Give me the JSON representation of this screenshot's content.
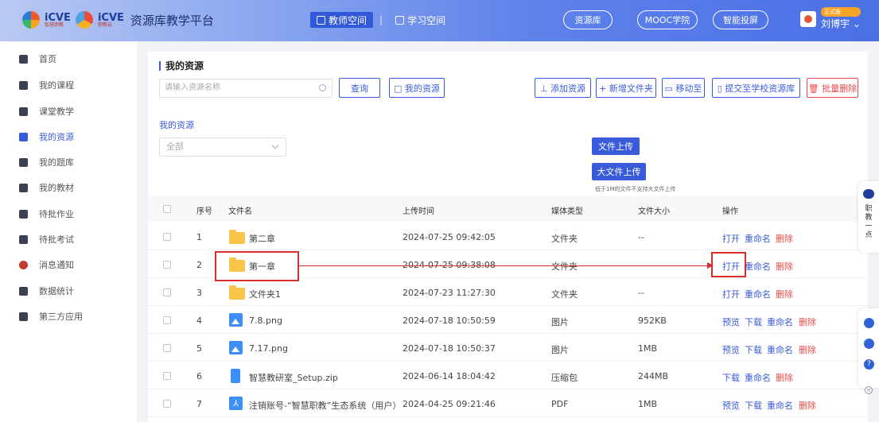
{
  "header": {
    "logo_text_1": "iCVE",
    "logo_sub_1": "智慧职教",
    "logo_text_2": "iCVE",
    "logo_sub_2": "职教云",
    "platform_title": "资源库教学平台",
    "nav_teacher": "教师空间",
    "nav_separator": "|",
    "nav_student": "学习空间",
    "pill_resource": "资源库",
    "pill_mooc": "MOOC学院",
    "pill_screen": "智能投屏",
    "user_badge": "正式版",
    "user_name": "刘博宇 ⌄"
  },
  "sidebar": {
    "items": [
      {
        "label": "首页",
        "icon": "home-icon"
      },
      {
        "label": "我的课程",
        "icon": "course-icon"
      },
      {
        "label": "课堂教学",
        "icon": "classroom-icon"
      },
      {
        "label": "我的资源",
        "icon": "resource-icon"
      },
      {
        "label": "我的题库",
        "icon": "question-bank-icon"
      },
      {
        "label": "我的教材",
        "icon": "textbook-icon"
      },
      {
        "label": "待批作业",
        "icon": "homework-icon"
      },
      {
        "label": "待批考试",
        "icon": "exam-icon"
      },
      {
        "label": "消息通知",
        "icon": "bell-icon"
      },
      {
        "label": "数据统计",
        "icon": "stats-icon"
      },
      {
        "label": "第三方应用",
        "icon": "apps-icon"
      }
    ]
  },
  "main": {
    "title": "我的资源",
    "search_placeholder": "请输入资源名称",
    "query_btn": "查询",
    "my_resource_btn": "□ 我的资源",
    "add_resource_btn": "⊥ 添加资源",
    "new_folder_btn": "+ 新增文件夹",
    "move_btn": "▭ 移动至",
    "submit_school_btn": "▯ 提交至学校资源库",
    "batch_delete_btn": "🗑 批量删除",
    "sub_label": "我的资源",
    "select_value": "全部",
    "upload_btn": "文件上传",
    "big_upload_btn": "大文件上传",
    "upload_note": "低于1M的文件不支持大文件上传"
  },
  "table": {
    "headers": {
      "index": "序号",
      "name": "文件名",
      "time": "上传时间",
      "type": "媒体类型",
      "size": "文件大小",
      "ops": "操作"
    },
    "rows": [
      {
        "index": "1",
        "name": "第二章",
        "time": "2024-07-25 09:42:05",
        "type": "文件夹",
        "size": "--",
        "icon": "folder",
        "ops": [
          "打开",
          "重命名",
          "删除"
        ]
      },
      {
        "index": "2",
        "name": "第一章",
        "time": "2024-07-25 09:38:08",
        "type": "文件夹",
        "size": "",
        "icon": "folder",
        "ops": [
          "打开",
          "重命名",
          "删除"
        ]
      },
      {
        "index": "3",
        "name": "文件夹1",
        "time": "2024-07-23 11:27:30",
        "type": "文件夹",
        "size": "--",
        "icon": "folder",
        "ops": [
          "打开",
          "重命名",
          "删除"
        ]
      },
      {
        "index": "4",
        "name": "7.8.png",
        "time": "2024-07-18 10:50:59",
        "type": "图片",
        "size": "952KB",
        "icon": "image",
        "ops": [
          "预览",
          "下载",
          "重命名",
          "删除"
        ]
      },
      {
        "index": "5",
        "name": "7.17.png",
        "time": "2024-07-18 10:50:37",
        "type": "图片",
        "size": "1MB",
        "icon": "image",
        "ops": [
          "预览",
          "下载",
          "重命名",
          "删除"
        ]
      },
      {
        "index": "6",
        "name": "智慧教研室_Setup.zip",
        "time": "2024-06-14 18:04:42",
        "type": "压缩包",
        "size": "244MB",
        "icon": "zip",
        "ops": [
          "下载",
          "重命名",
          "删除"
        ]
      },
      {
        "index": "7",
        "name": "注销账号-“智慧职教”生态系统（用户）操作",
        "time": "2024-04-25 09:21:46",
        "type": "PDF",
        "size": "1MB",
        "icon": "pdf",
        "ops": [
          "预览",
          "下载",
          "重命名",
          "删除"
        ]
      }
    ]
  },
  "float": {
    "label": "职教一点",
    "help": "?",
    "close": "×"
  },
  "colors": {
    "accent": "#3a5bd9",
    "danger": "#e94a4a",
    "annotation": "#d62d2d",
    "folder": "#f8c54a"
  }
}
